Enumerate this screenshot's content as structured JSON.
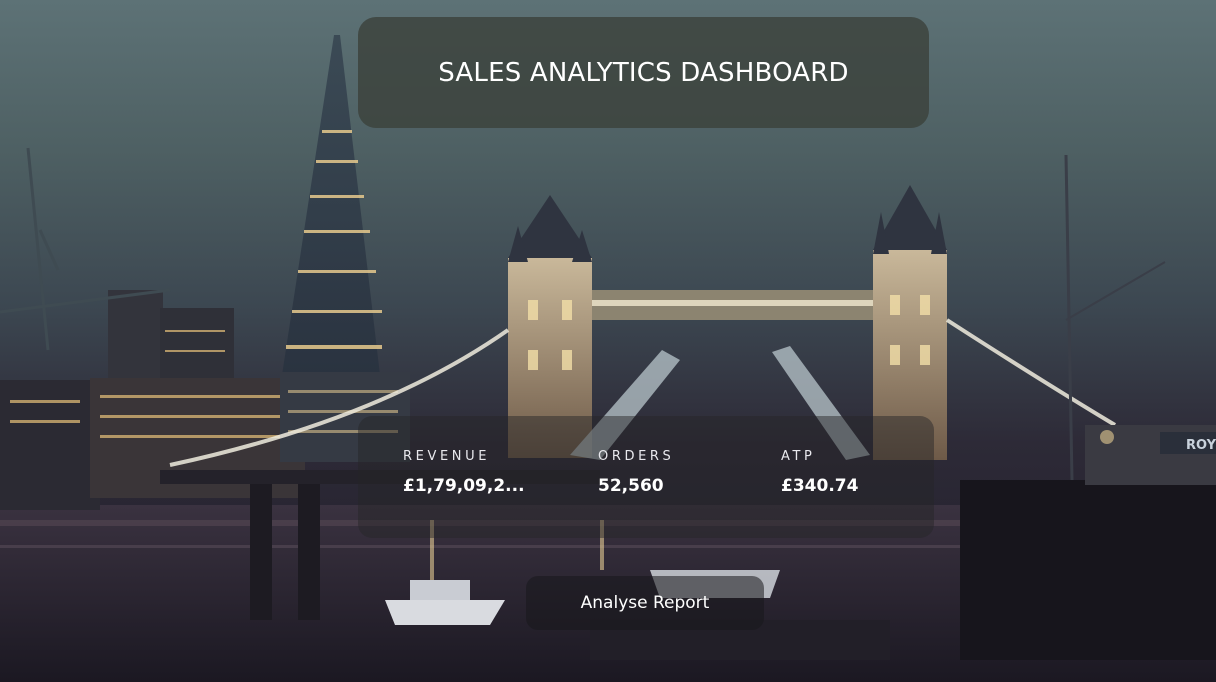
{
  "header": {
    "title": "SALES ANALYTICS DASHBOARD"
  },
  "kpis": {
    "revenue": {
      "label": "REVENUE",
      "value": "£1,79,09,2..."
    },
    "orders": {
      "label": "ORDERS",
      "value": "52,560"
    },
    "atp": {
      "label": "ATP",
      "value": "£340.74"
    }
  },
  "actions": {
    "analyse_label": "Analyse Report"
  },
  "background": {
    "signage_text": "ROY"
  },
  "colors": {
    "card_text": "#ffffff",
    "title_card": "#3c423c",
    "kpi_card": "#262628"
  }
}
